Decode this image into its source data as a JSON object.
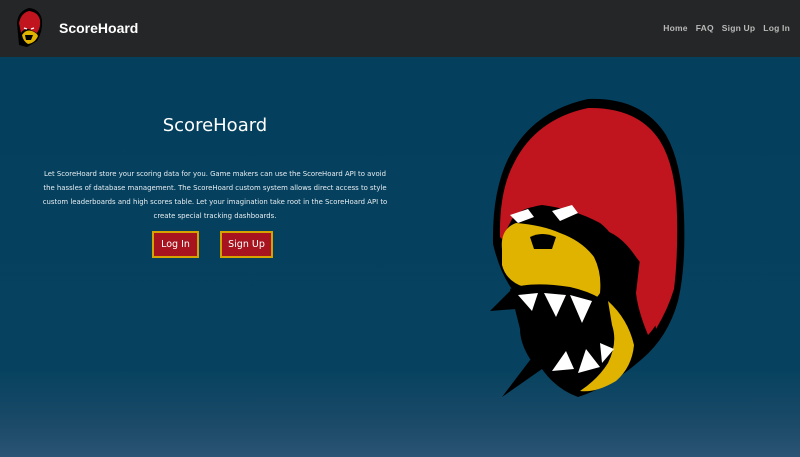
{
  "navbar": {
    "brand": "ScoreHoard",
    "links": [
      "Home",
      "FAQ",
      "Sign Up",
      "Log In"
    ]
  },
  "hero": {
    "title": "ScoreHoard",
    "description": "Let ScoreHoard store your scoring data for you. Game makers can use the ScoreHoard API to avoid the hassles of database management. The ScoreHoard custom system allows direct access to style custom leaderboards and high scores table. Let your imagination take root in the ScoreHoard API to create special tracking dashboards.",
    "login_label": "Log In",
    "signup_label": "Sign Up"
  },
  "colors": {
    "navbar_bg": "#252627",
    "hero_bg": "#06415f",
    "button_bg": "#a7141f",
    "button_border": "#d5a300",
    "mascot_red": "#c0141e",
    "mascot_yellow": "#dfb300"
  },
  "icons": {
    "brand": "gorilla-logo-icon",
    "mascot": "gorilla-mascot-icon"
  }
}
